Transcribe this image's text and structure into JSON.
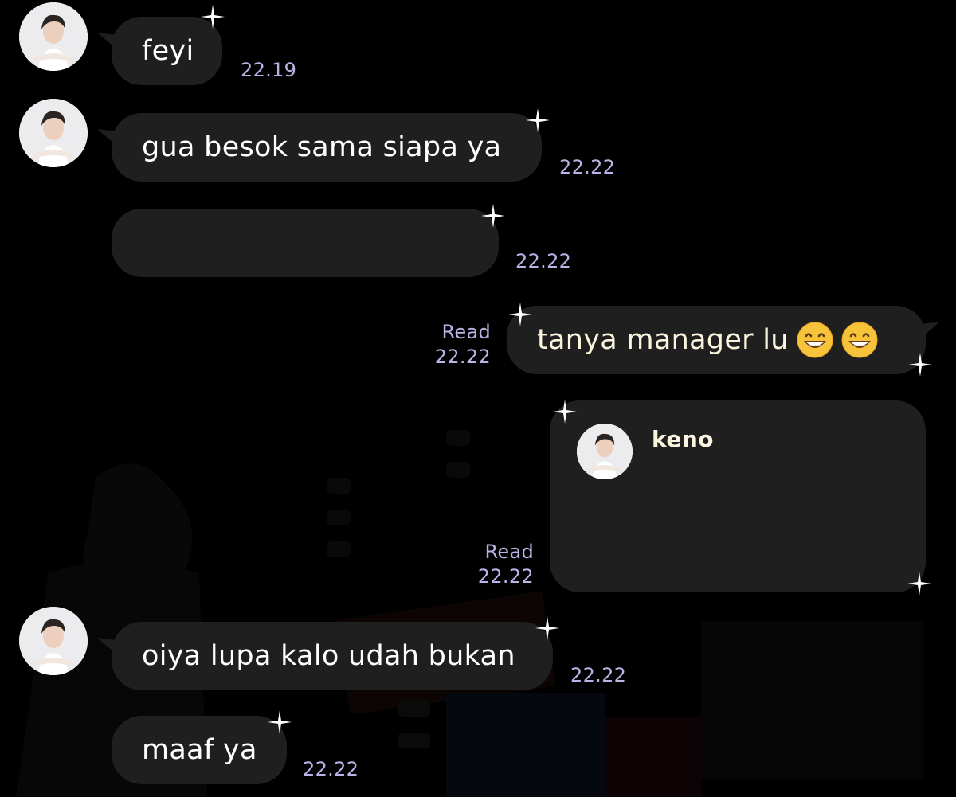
{
  "chat": {
    "messages": [
      {
        "text": "feyi",
        "time": "22.19"
      },
      {
        "text": "gua besok sama siapa ya",
        "time": "22.22"
      },
      {
        "text": "",
        "time": "22.22"
      },
      {
        "text": "tanya manager lu",
        "status": "Read",
        "time": "22.22"
      },
      {
        "status": "Read",
        "time": "22.22"
      },
      {
        "text": "oiya lupa kalo udah bukan",
        "time": "22.22"
      },
      {
        "text": "maaf ya",
        "time": "22.22"
      }
    ],
    "contact_card": {
      "name": "keno"
    }
  },
  "colors": {
    "background": "#000000",
    "bubble": "#1f1f1f",
    "timestamp": "#b9b3e6",
    "outgoing_text": "#fbf4de"
  },
  "icons": [
    "avatar",
    "sparkle-icon",
    "grinning-emoji-icon"
  ]
}
